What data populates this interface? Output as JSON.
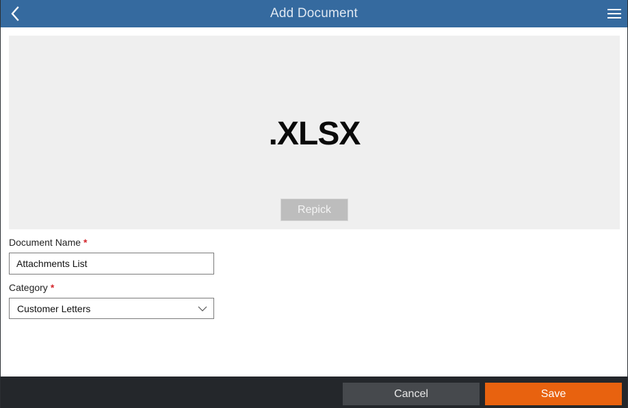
{
  "header": {
    "title": "Add Document",
    "back_icon": "chevron-left-icon",
    "menu_icon": "hamburger-menu-icon"
  },
  "preview": {
    "file_extension": ".XLSX",
    "repick_label": "Repick"
  },
  "form": {
    "document_name": {
      "label": "Document Name",
      "required_marker": "*",
      "value": "Attachments List"
    },
    "category": {
      "label": "Category",
      "required_marker": "*",
      "value": "Customer Letters",
      "icon": "chevron-down-icon"
    }
  },
  "footer": {
    "cancel_label": "Cancel",
    "save_label": "Save"
  },
  "colors": {
    "header_bg": "#356a9f",
    "accent_save": "#e8620f",
    "footer_bg": "#24272b",
    "required": "#d4262c"
  }
}
